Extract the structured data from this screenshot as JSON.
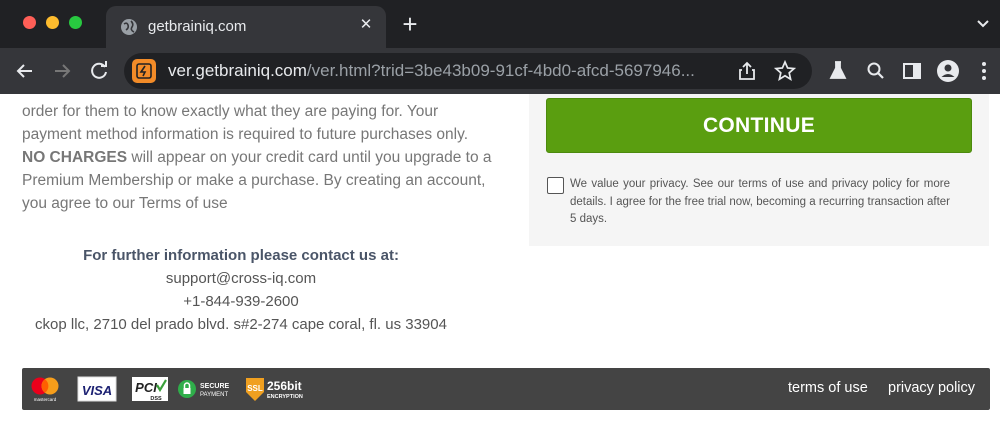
{
  "browser": {
    "tab_title": "getbrainiq.com",
    "url_host": "ver.getbrainiq.com",
    "url_rest": "/ver.html?trid=3be43b09-91cf-4bd0-afcd-5697946..."
  },
  "page": {
    "intro_line1": "order for them to know exactly what they are paying for. Your",
    "intro_line2": "payment method information is required to future purchases only.",
    "no_charges": "NO CHARGES",
    "intro_line3_rest": " will appear on your credit card until you upgrade to a",
    "intro_line4": "Premium Membership or make a purchase. By creating an account,",
    "intro_line5": "you agree to our Terms of use",
    "continue_label": "CONTINUE",
    "privacy_text": "We value your privacy. See our terms of use and privacy policy for more details. I agree for the free trial now, becoming a recurring transaction after 5 days.",
    "contact_heading": "For further information please contact us at:",
    "contact_email": "support@cross-iq.com",
    "contact_phone": "+1-844-939-2600",
    "contact_address": "ckop llc, 2710 del prado blvd. s#2-274 cape coral, fl. us 33904"
  },
  "footer": {
    "badges": {
      "mastercard": "mastercard",
      "visa": "VISA",
      "pci": "PCI",
      "pci_sub": "DSS",
      "secure_top": "SECURE",
      "secure_bottom": "PAYMENT",
      "ssl": "SSL",
      "ssl_bits": "256bit",
      "ssl_sub": "ENCRYPTION"
    },
    "terms_label": "terms of use",
    "privacy_label": "privacy policy"
  },
  "colors": {
    "continue_green": "#5a9e10",
    "footer_bg": "#444444",
    "chrome_dark": "#202124"
  }
}
